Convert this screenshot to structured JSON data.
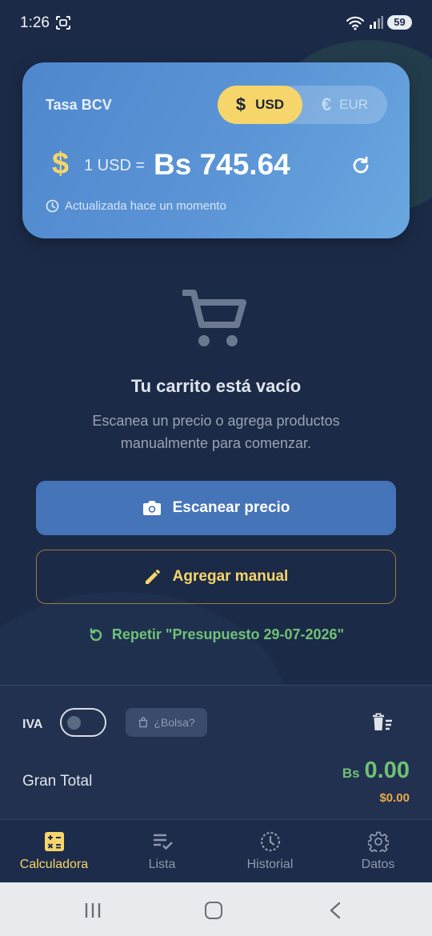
{
  "status_bar": {
    "time": "1:26",
    "battery": "59"
  },
  "rate_card": {
    "label": "Tasa BCV",
    "toggle": {
      "usd_symbol": "$",
      "usd": "USD",
      "eur_symbol": "€",
      "eur": "EUR",
      "selected": "USD"
    },
    "symbol": "$",
    "prefix": "1 USD =",
    "value": "Bs 745.64",
    "updated": "Actualizada hace un momento"
  },
  "empty_state": {
    "title": "Tu carrito está vacío",
    "description": "Escanea un precio o agrega productos manualmente para comenzar."
  },
  "actions": {
    "scan": "Escanear precio",
    "manual": "Agregar manual",
    "repeat": "Repetir \"Presupuesto 29-07-2026\""
  },
  "summary": {
    "iva_label": "IVA",
    "iva_enabled": false,
    "bolsa": "¿Bolsa?",
    "total_label": "Gran Total",
    "total_bs_currency": "Bs",
    "total_bs_value": "0.00",
    "total_usd": "$0.00"
  },
  "nav": {
    "items": [
      {
        "label": "Calculadora",
        "icon": "calculator-icon",
        "active": true
      },
      {
        "label": "Lista",
        "icon": "checklist-icon",
        "active": false
      },
      {
        "label": "Historial",
        "icon": "history-icon",
        "active": false
      },
      {
        "label": "Datos",
        "icon": "gear-icon",
        "active": false
      }
    ]
  },
  "colors": {
    "accent_yellow": "#f6d66a",
    "accent_green": "#6fc176",
    "primary_blue": "#4674b9",
    "background": "#1b2a47"
  }
}
